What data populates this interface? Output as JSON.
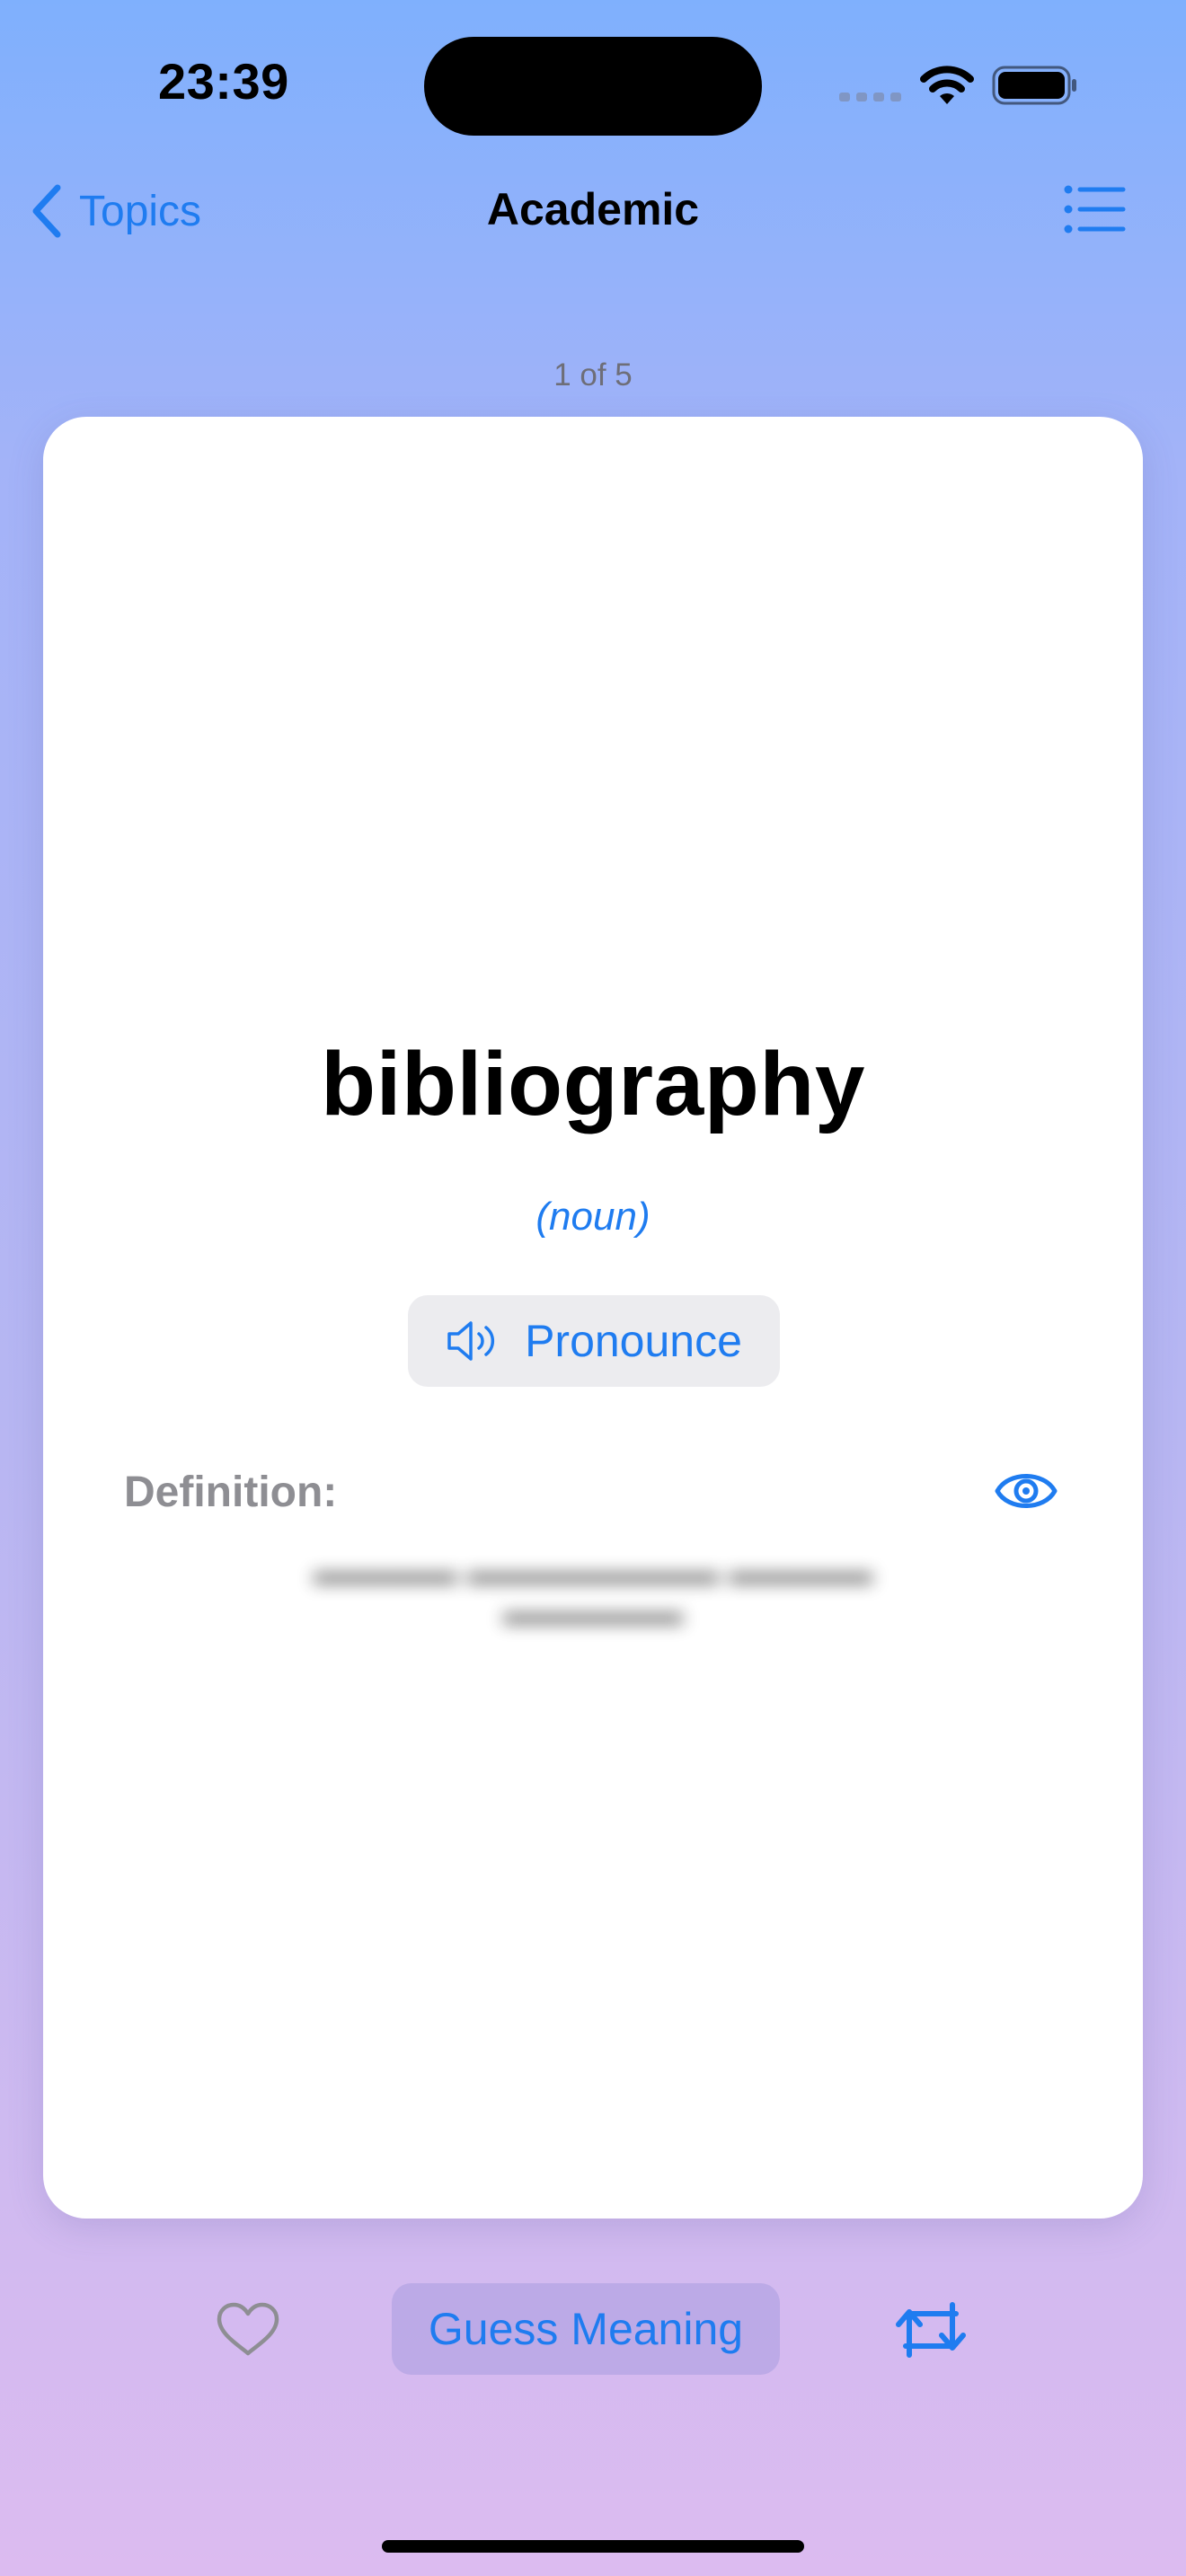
{
  "status_bar": {
    "time": "23:39"
  },
  "nav": {
    "back_label": "Topics",
    "title": "Academic"
  },
  "counter": "1 of 5",
  "card": {
    "word": "bibliography",
    "part_of_speech": "(noun)",
    "pronounce_label": "Pronounce",
    "definition_label": "Definition:",
    "definition_text_hidden": true
  },
  "bottom_bar": {
    "guess_label": "Guess Meaning"
  },
  "colors": {
    "accent": "#1f7cf0",
    "card_bg": "#ffffff",
    "label_gray": "#8e8e93"
  },
  "icons": [
    "chevron-left-icon",
    "list-icon",
    "speaker-icon",
    "eye-icon",
    "heart-icon",
    "flip-icon",
    "wifi-icon",
    "battery-icon",
    "signal-icon"
  ]
}
